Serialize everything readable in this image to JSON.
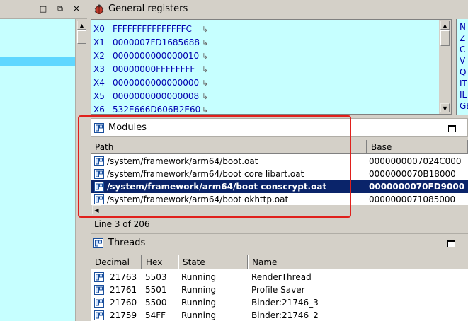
{
  "left_panel": {
    "title_buttons": [
      "□",
      "⧉",
      "✕"
    ]
  },
  "registers": {
    "title": "General registers",
    "rows": [
      {
        "name": "X0",
        "value": "FFFFFFFFFFFFFFFC"
      },
      {
        "name": "X1",
        "value": "0000007FD1685688"
      },
      {
        "name": "X2",
        "value": "0000000000000010"
      },
      {
        "name": "X3",
        "value": "00000000FFFFFFFF"
      },
      {
        "name": "X4",
        "value": "0000000000000000"
      },
      {
        "name": "X5",
        "value": "0000000000000008"
      },
      {
        "name": "X6",
        "value": "532E666D606B2E60"
      }
    ],
    "arrow_glyph": "↳",
    "flags": [
      "N",
      "Z",
      "C",
      "V",
      "Q",
      "IT",
      "IL",
      "GE"
    ]
  },
  "modules": {
    "title": "Modules",
    "columns": [
      "Path",
      "Base"
    ],
    "rows": [
      {
        "path": "/system/framework/arm64/boot.oat",
        "base": "0000000007024C000"
      },
      {
        "path": "/system/framework/arm64/boot core libart.oat",
        "base": "0000000070B18000"
      },
      {
        "path": "/system/framework/arm64/boot conscrypt.oat",
        "base": "0000000070FD9000"
      },
      {
        "path": "/system/framework/arm64/boot okhttp.oat",
        "base": "0000000071085000"
      }
    ],
    "selected_index": 2,
    "status": "Line 3 of 206"
  },
  "threads": {
    "title": "Threads",
    "columns": [
      "Decimal",
      "Hex",
      "State",
      "Name"
    ],
    "rows": [
      {
        "decimal": "21763",
        "hex": "5503",
        "state": "Running",
        "name": "RenderThread"
      },
      {
        "decimal": "21761",
        "hex": "5501",
        "state": "Running",
        "name": "Profile Saver"
      },
      {
        "decimal": "21760",
        "hex": "5500",
        "state": "Running",
        "name": "Binder:21746_3"
      },
      {
        "decimal": "21759",
        "hex": "54FF",
        "state": "Running",
        "name": "Binder:21746_2"
      }
    ]
  },
  "colors": {
    "panel_bg": "#c6ffff",
    "selection": "#0a246a",
    "highlight": "#e0201c",
    "register_text": "#0000b0"
  }
}
